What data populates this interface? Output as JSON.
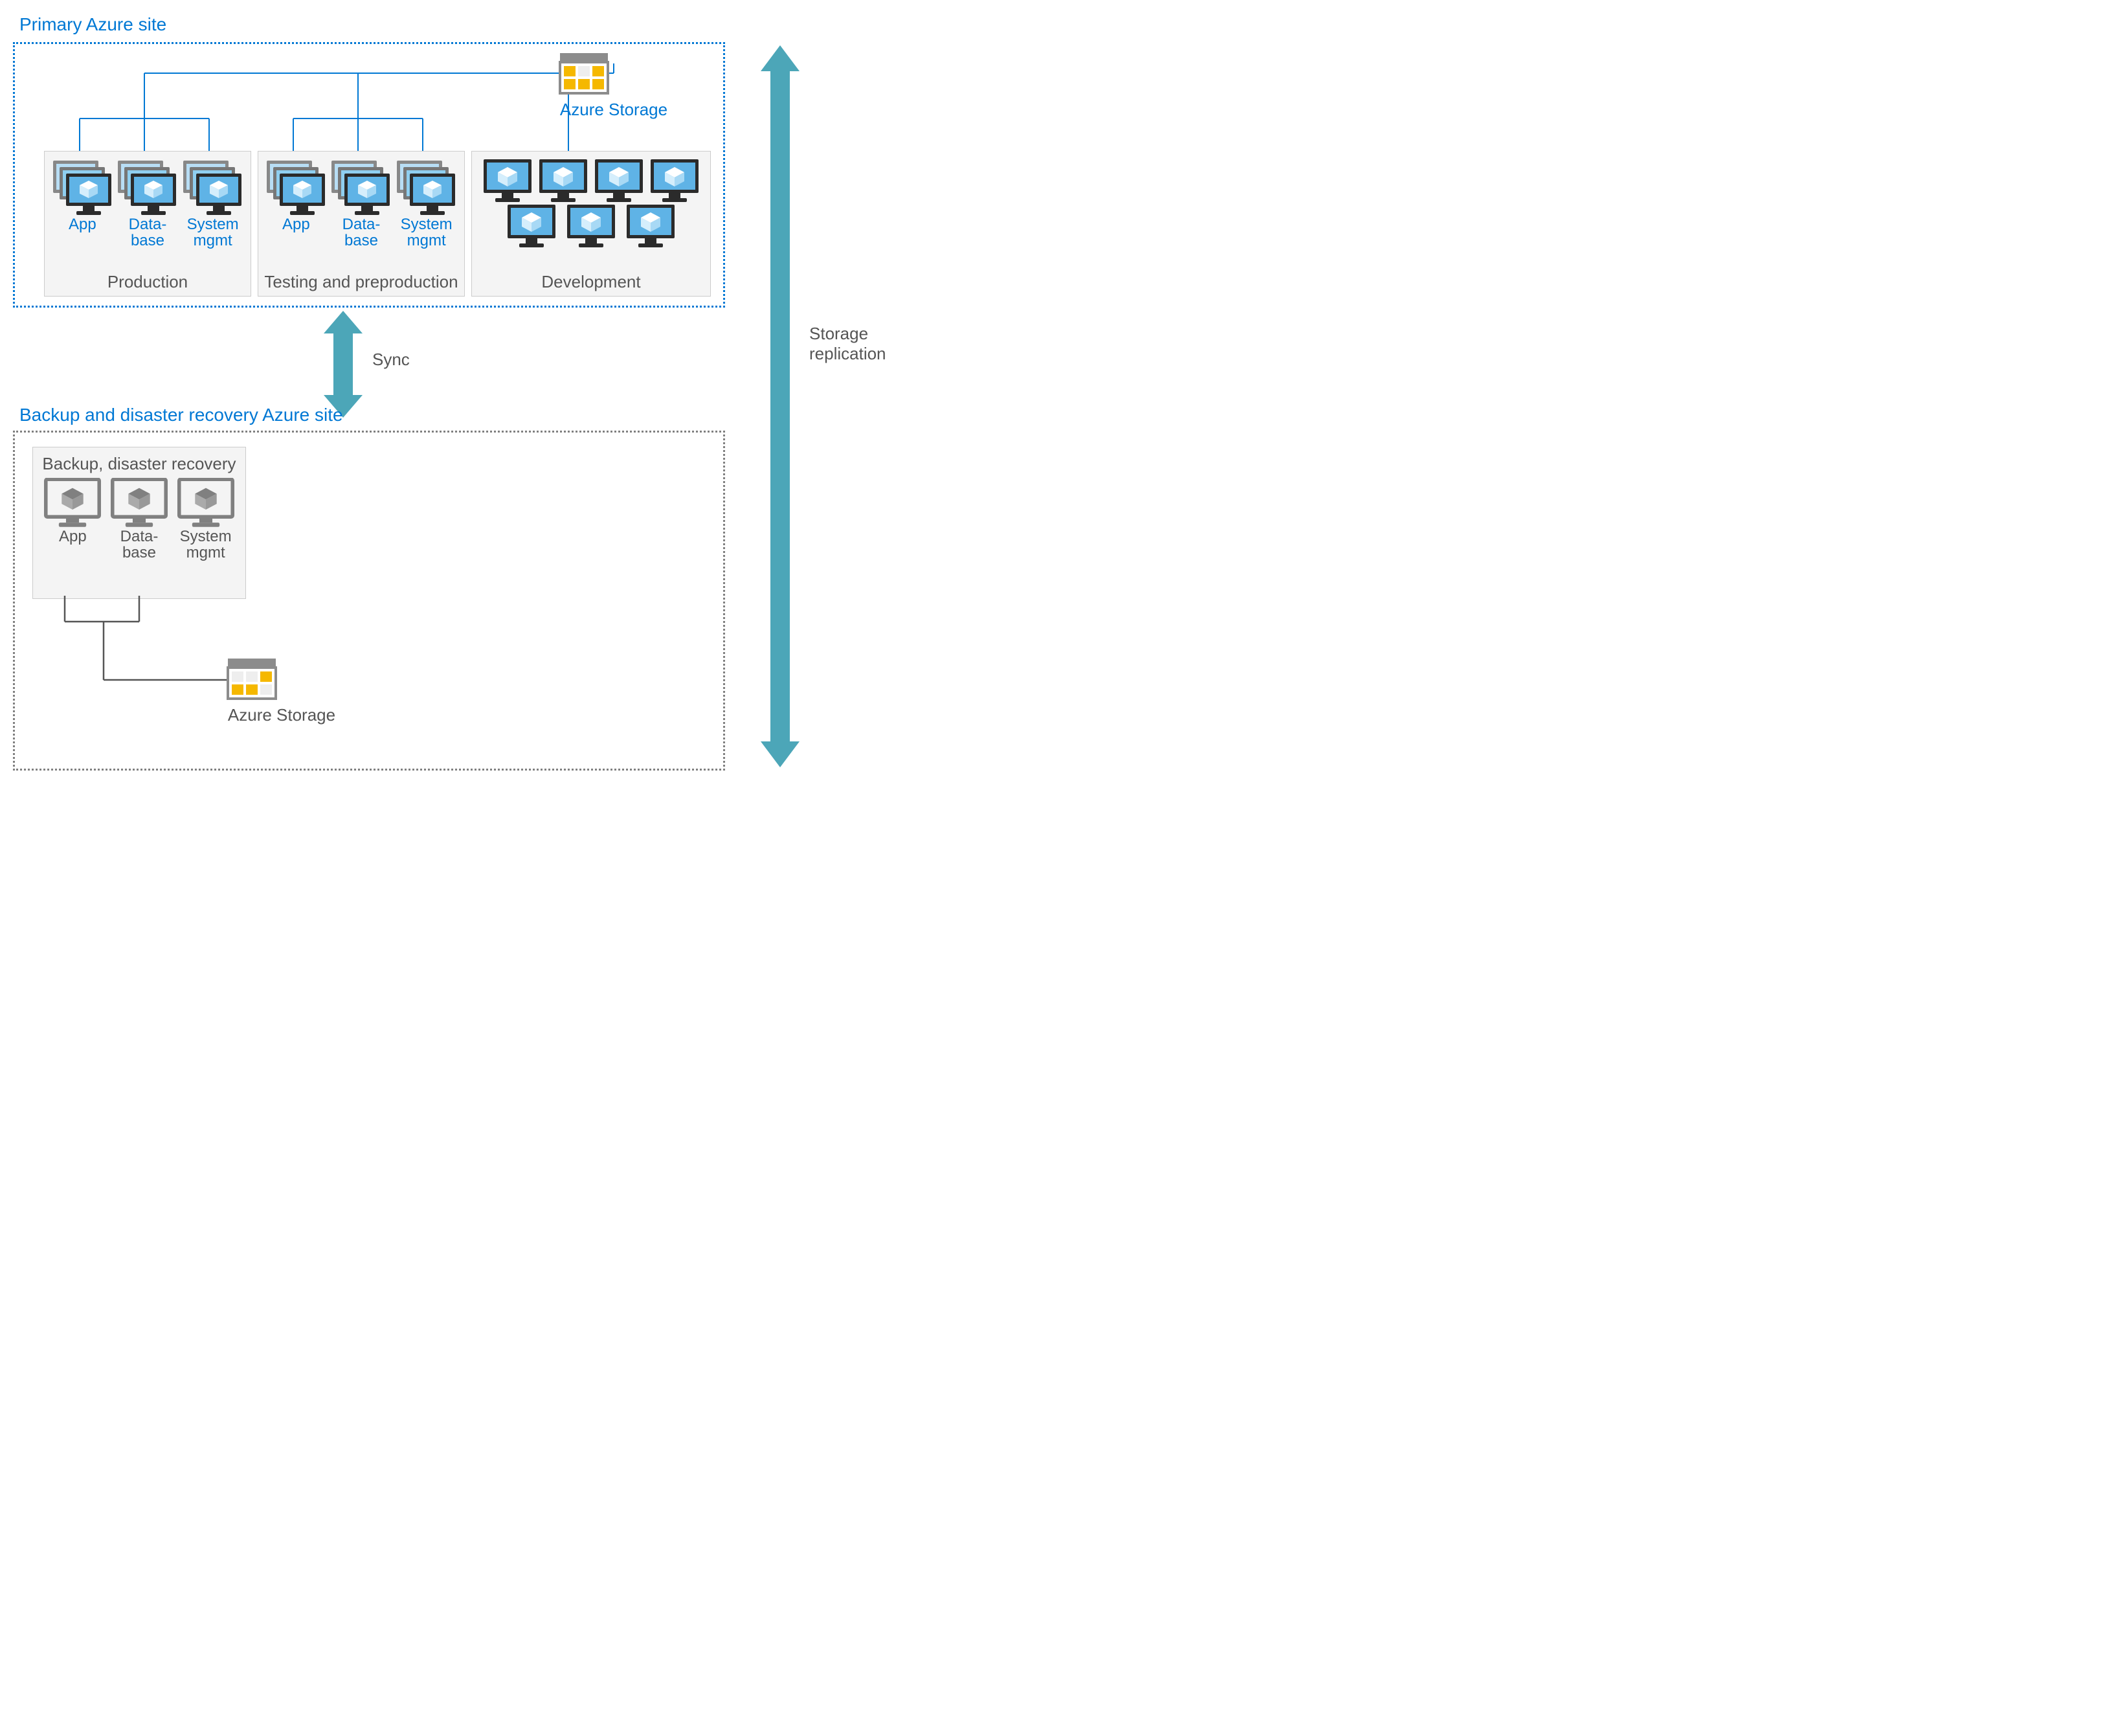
{
  "primary": {
    "title": "Primary Azure site",
    "storage_label": "Azure Storage",
    "groups": {
      "production": {
        "title": "Production",
        "items": [
          "App",
          "Data-\nbase",
          "System\nmgmt"
        ]
      },
      "testing": {
        "title": "Testing and preproduction",
        "items": [
          "App",
          "Data-\nbase",
          "System\nmgmt"
        ]
      },
      "development": {
        "title": "Development"
      }
    }
  },
  "backup": {
    "title": "Backup and disaster recovery Azure site",
    "group_title": "Backup, disaster recovery",
    "items": [
      "App",
      "Data-\nbase",
      "System\nmgmt"
    ],
    "storage_label": "Azure Storage"
  },
  "annotations": {
    "sync": "Sync",
    "storage_replication": "Storage\nreplication"
  },
  "colors": {
    "azure_blue": "#0078d4",
    "teal_arrow": "#4ca6b8",
    "gray": "#808080"
  }
}
